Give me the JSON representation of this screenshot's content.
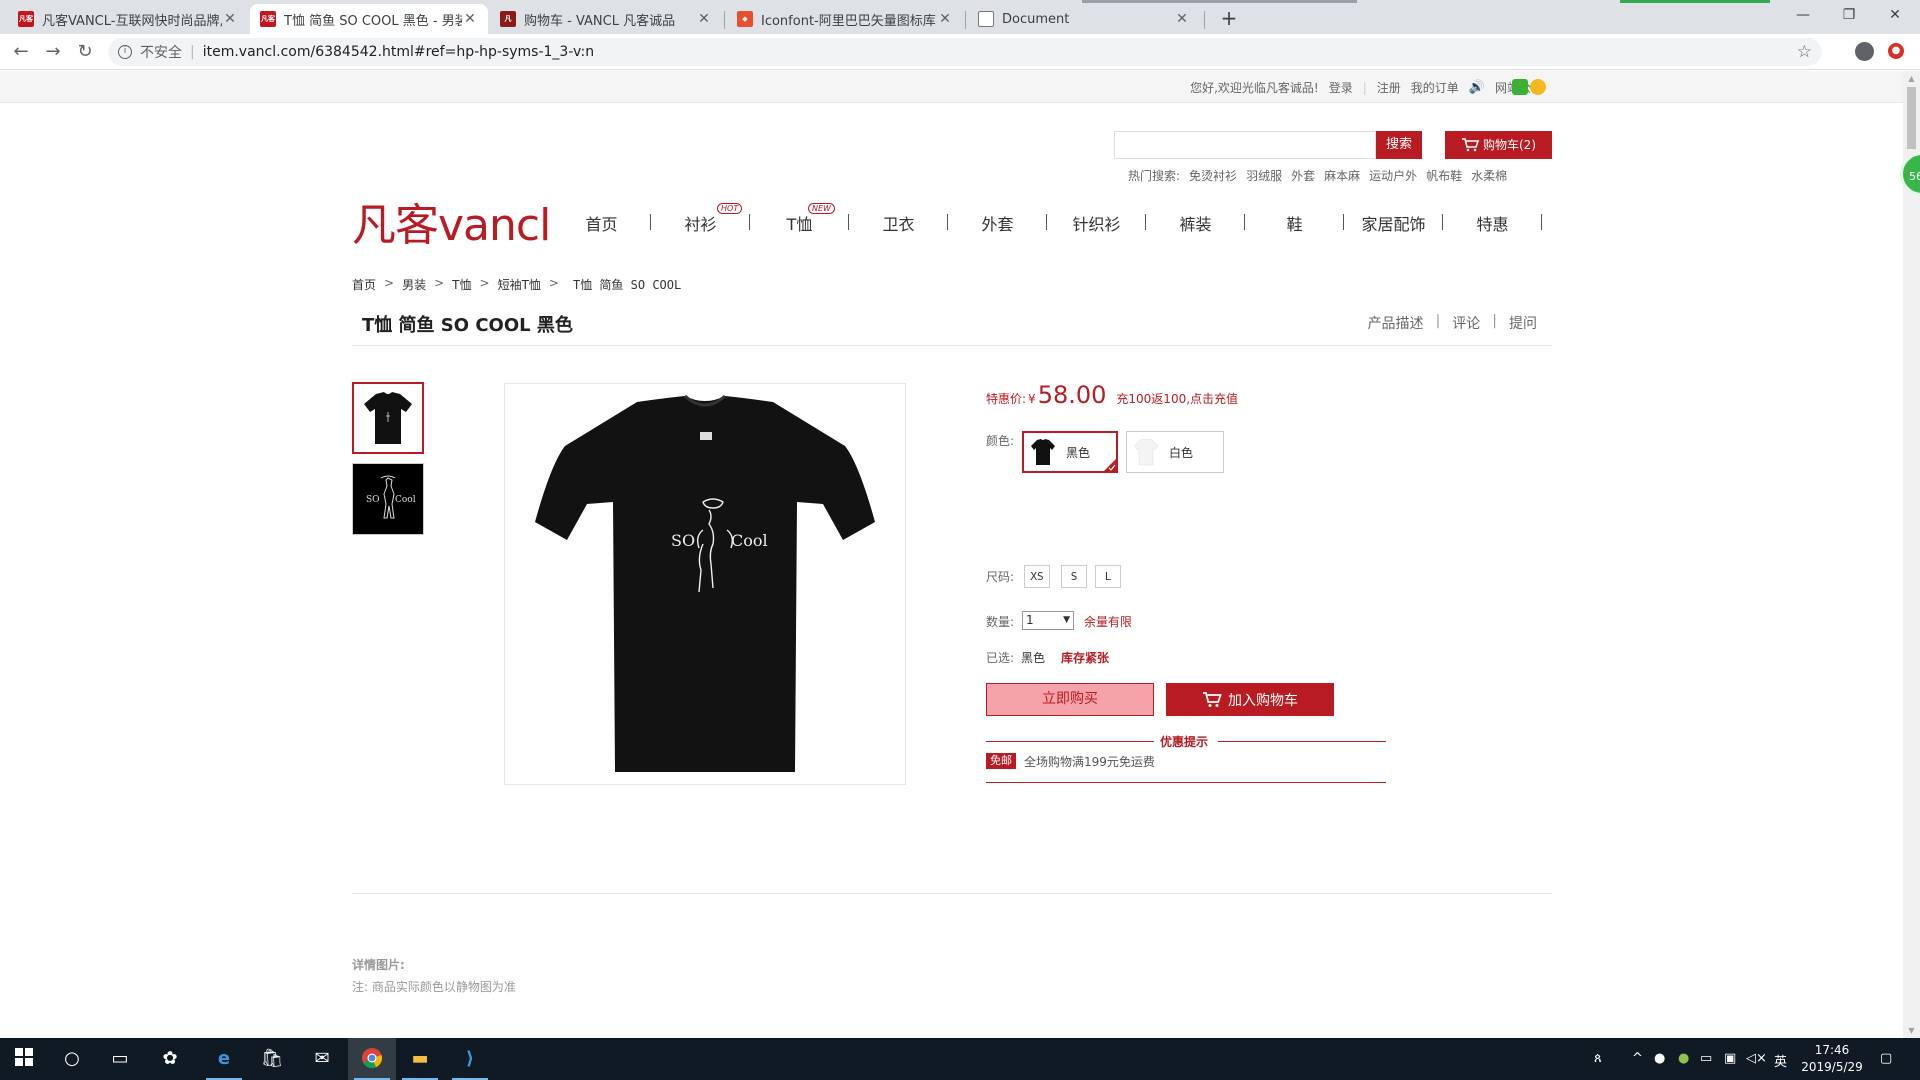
{
  "browser": {
    "tabs": [
      {
        "title": "凡客VANCL-互联网快时尚品牌,",
        "favicon_color": "#c2151c",
        "favicon_text": "凡客"
      },
      {
        "title": "T恤 简鱼 SO COOL 黑色 - 男装",
        "favicon_color": "#c2151c",
        "favicon_text": "凡客"
      },
      {
        "title": "购物车 - VANCL 凡客诚品",
        "favicon_color": "#8b1a1a",
        "favicon_text": "凡"
      },
      {
        "title": "Iconfont-阿里巴巴矢量图标库",
        "favicon_color": "#e94e2e",
        "favicon_text": "◆"
      },
      {
        "title": "Document",
        "favicon_color": "#ffffff",
        "favicon_text": ""
      }
    ],
    "address": {
      "security": "不安全",
      "url": "item.vancl.com/6384542.html#ref=hp-hp-syms-1_3-v:n"
    }
  },
  "page": {
    "top_strip": {
      "welcome": "您好,欢迎光临凡客诚品!",
      "login": "登录",
      "register": "注册",
      "my_orders": "我的订单",
      "notice": "网站公告"
    },
    "search": {
      "placeholder": "",
      "button": "搜索",
      "cart": "购物车(2)",
      "hot_label": "热门搜索:",
      "hot_terms": [
        "免烫衬衫",
        "羽绒服",
        "外套",
        "麻本麻",
        "运动户外",
        "帆布鞋",
        "水柔棉"
      ]
    },
    "logo": "凡客vancl",
    "nav": {
      "items": [
        "首页",
        "衬衫",
        "T恤",
        "卫衣",
        "外套",
        "针织衫",
        "裤装",
        "鞋",
        "家居配饰",
        "特惠"
      ],
      "badge_hot": "HOT",
      "badge_new": "NEW"
    },
    "breadcrumb": [
      "首页",
      "男装",
      "T恤",
      "短袖T恤",
      "T恤 简鱼 SO COOL"
    ],
    "product": {
      "title": "T恤 简鱼 SO COOL 黑色",
      "tabs": [
        "产品描述",
        "评论",
        "提问"
      ],
      "image_text_so": "SO",
      "image_text_cool": "Cool",
      "price_label": "特惠价:",
      "currency": "¥",
      "price": "58.00",
      "recharge": "充100返100,点击充值",
      "color_label": "颜色:",
      "colors": [
        "黑色",
        "白色"
      ],
      "size_label": "尺码:",
      "sizes": [
        "XS",
        "S",
        "L"
      ],
      "qty_label": "数量:",
      "qty_value": "1",
      "qty_note": "余量有限",
      "selected_label": "已选:",
      "selected_value": "黑色",
      "stock_note": "库存紧张",
      "buy_now": "立即购买",
      "add_to_cart": "加入购物车",
      "promo_title": "优惠提示",
      "promo_tag": "免邮",
      "promo_text": "全场购物满199元免运费"
    },
    "details": {
      "title": "详情图片:",
      "note": "注:  商品实际颜色以静物图为准"
    }
  },
  "taskbar": {
    "time": "17:46",
    "date": "2019/5/29",
    "ime": "英"
  }
}
